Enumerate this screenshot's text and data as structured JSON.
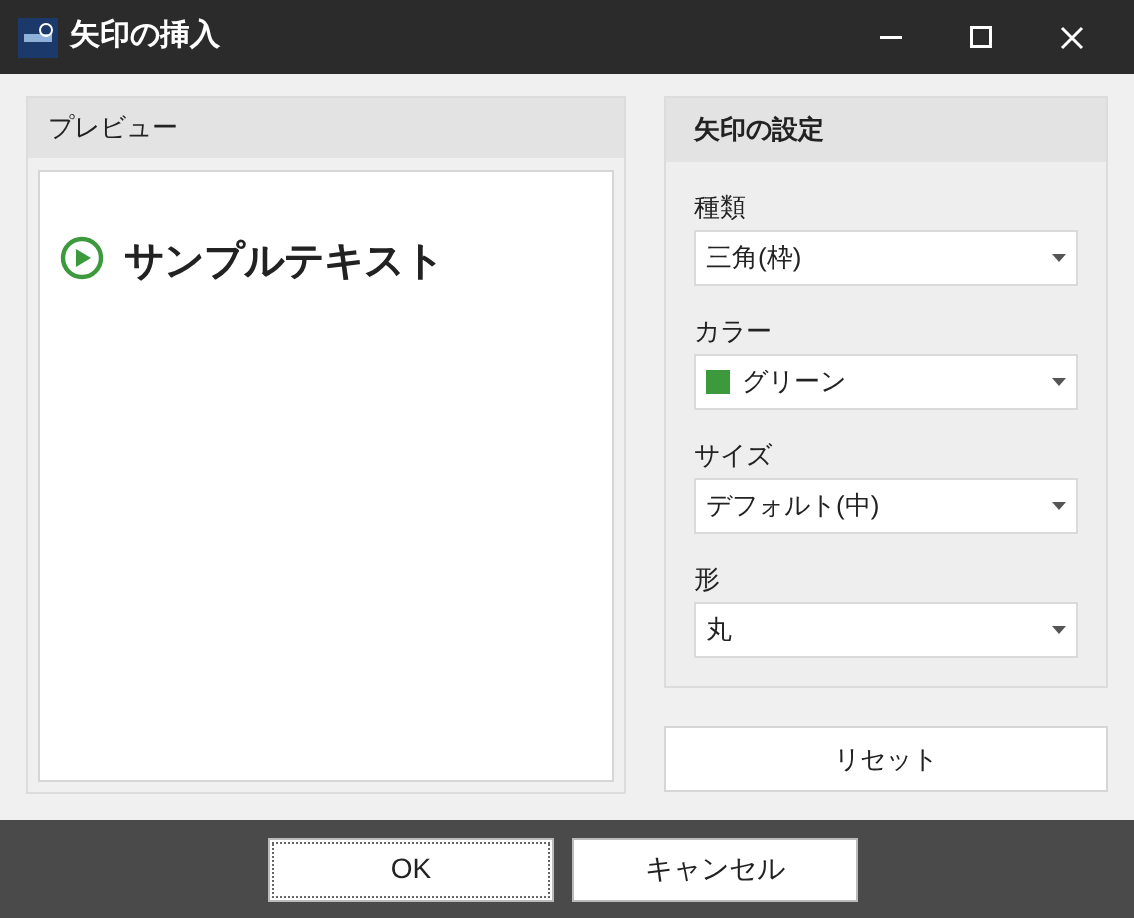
{
  "window": {
    "title": "矢印の挿入"
  },
  "preview": {
    "header": "プレビュー",
    "sample_text": "サンプルテキスト"
  },
  "settings": {
    "header": "矢印の設定",
    "fields": [
      {
        "label": "種類",
        "value": "三角(枠)"
      },
      {
        "label": "カラー",
        "value": "グリーン",
        "color": "#3c9a3c"
      },
      {
        "label": "サイズ",
        "value": "デフォルト(中)"
      },
      {
        "label": "形",
        "value": "丸"
      }
    ],
    "reset_button": "リセット"
  },
  "buttons": [
    {
      "label": "OK",
      "focused": true
    },
    {
      "label": "キャンセル",
      "focused": false
    }
  ]
}
